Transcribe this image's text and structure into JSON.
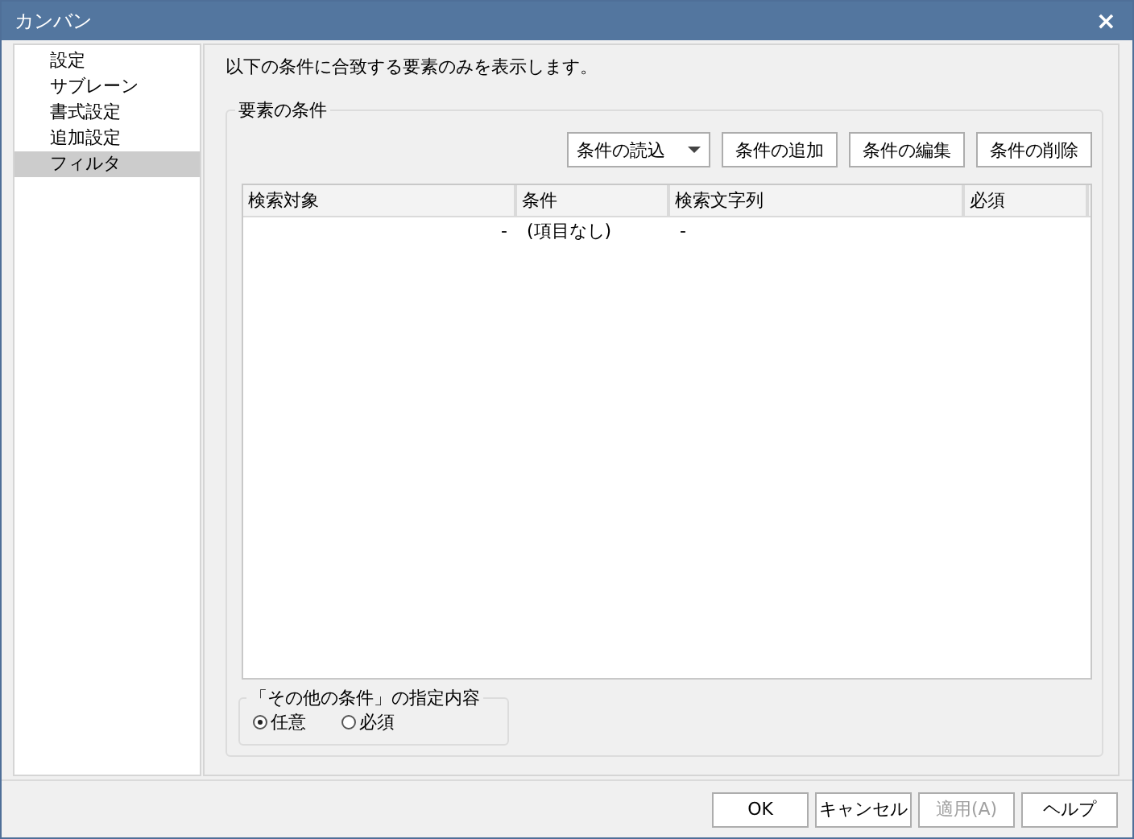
{
  "window": {
    "title": "カンバン",
    "close": "×"
  },
  "sidebar": {
    "items": [
      {
        "label": "設定",
        "selected": false
      },
      {
        "label": "サブレーン",
        "selected": false
      },
      {
        "label": "書式設定",
        "selected": false
      },
      {
        "label": "追加設定",
        "selected": false
      },
      {
        "label": "フィルタ",
        "selected": true
      }
    ]
  },
  "description": "以下の条件に合致する要素のみを表示します。",
  "conditions_group": {
    "title": "要素の条件",
    "buttons": [
      {
        "label": "条件の読込",
        "kind": "dropdown"
      },
      {
        "label": "条件の追加",
        "kind": "plain"
      },
      {
        "label": "条件の編集",
        "kind": "plain"
      },
      {
        "label": "条件の削除",
        "kind": "plain"
      }
    ],
    "table": {
      "columns": [
        "検索対象",
        "条件",
        "検索文字列",
        "必須"
      ],
      "rows": [
        [
          "-",
          "(項目なし)",
          "-",
          ""
        ]
      ]
    }
  },
  "other_group": {
    "title": "「その他の条件」の指定内容",
    "options": [
      {
        "label": "任意",
        "selected": true
      },
      {
        "label": "必須",
        "selected": false
      }
    ]
  },
  "footer_buttons": [
    {
      "label": "OK",
      "disabled": false
    },
    {
      "label": "キャンセル",
      "disabled": false
    },
    {
      "label": "適用(A)",
      "disabled": true
    },
    {
      "label": "ヘルプ",
      "disabled": false
    }
  ]
}
